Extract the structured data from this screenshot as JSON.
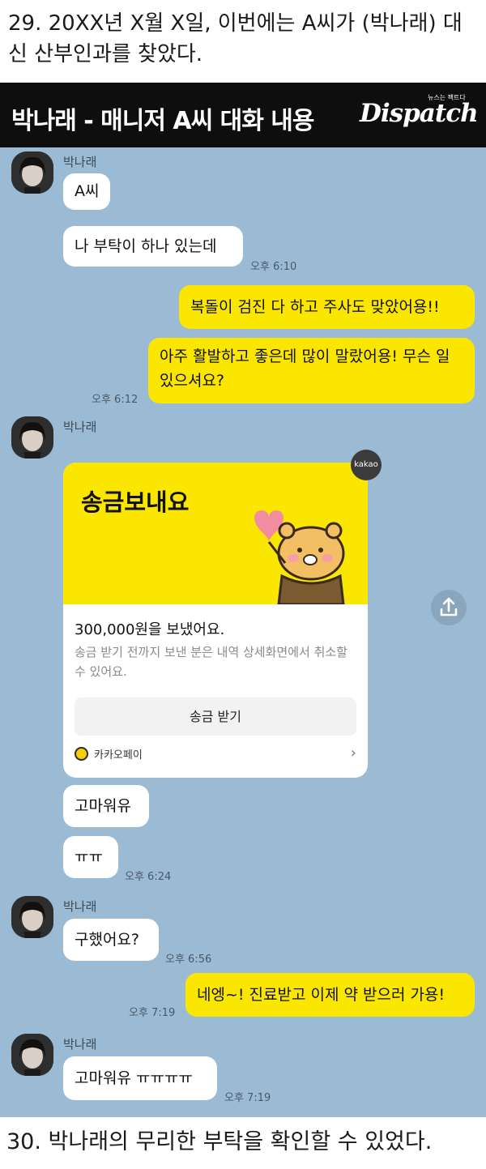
{
  "caption_top": "29. 20XX년 X월 X일, 이번에는 A씨가 (박나래) 대신 산부인과를 찾았다.",
  "banner": {
    "title": "박나래 - 매니저 A씨 대화 내용",
    "logo": "Dispatch",
    "logo_tag": "뉴스는 팩트다"
  },
  "chat": {
    "sender_name": "박나래",
    "messages": {
      "m1": "A씨",
      "m2": "나 부탁이 하나 있는데",
      "t1": "오후 6:10",
      "m3": "복돌이 검진 다 하고 주사도 맞았어용!!",
      "m4": "아주 활발하고 좋은데 많이 말랐어용! 무슨 일 있으셔요?",
      "t2": "오후 6:12",
      "m5": "고마워유",
      "m6": "ㅠㅠ",
      "t3": "오후 6:24",
      "m7": "구했어요?",
      "t4": "오후 6:56",
      "m8": "네엥~! 진료받고 이제 약 받으러 가용!",
      "t5": "오후 7:19",
      "m9": "고마워유 ㅠㅠㅠㅠ",
      "t6": "오후 7:19"
    },
    "transfer_card": {
      "badge": "kakao",
      "title": "송금보내요",
      "amount_text": "300,000원을 보냈어요.",
      "description": "송금 받기 전까지 보낸 분은 내역 상세화면에서 취소할 수 있어요.",
      "button_label": "송금 받기",
      "pay_label": "카카오페이"
    }
  },
  "caption_bottom": "30. 박나래의 무리한 부탁을 확인할 수 있었다."
}
